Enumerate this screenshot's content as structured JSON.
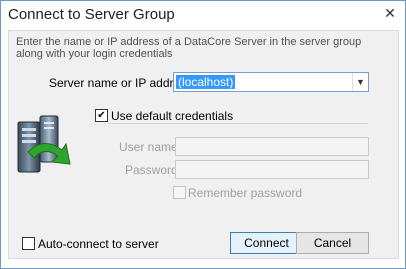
{
  "window": {
    "title": "Connect to Server Group",
    "close_glyph": "✕"
  },
  "instructions": "Enter the name or IP address of a DataCore Server in the server group along with your login credentials",
  "server": {
    "label": "Server name or IP address:",
    "value": "(localhost)"
  },
  "use_default_credentials": {
    "label": "Use default credentials",
    "checked": true,
    "check_glyph": "✔"
  },
  "user_name": {
    "label": "User name:",
    "value": ""
  },
  "password": {
    "label": "Password:",
    "value": ""
  },
  "remember_password": {
    "label": "Remember password",
    "checked": false
  },
  "auto_connect": {
    "label": "Auto-connect to server",
    "checked": false
  },
  "buttons": {
    "connect": "Connect",
    "cancel": "Cancel"
  },
  "icons": {
    "server": "server-tower-icon",
    "arrow": "green-connect-arrow-icon",
    "dropdown": "chevron-down-icon"
  },
  "colors": {
    "accent": "#3399ff",
    "arrow_green": "#2fa52f",
    "window_border": "#6d97c4"
  }
}
